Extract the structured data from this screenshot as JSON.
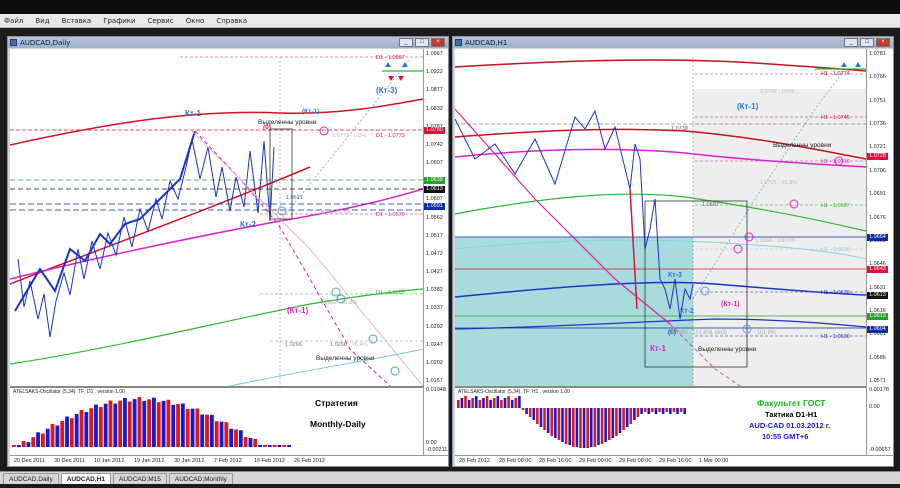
{
  "menu": [
    "Файл",
    "Вид",
    "Вставка",
    "Графики",
    "Сервис",
    "Окно",
    "Справка"
  ],
  "colors": {
    "accent_blue": "#2f74d0",
    "annot_red": "#e0103a",
    "magenta": "#e020c8",
    "green": "#2db82d",
    "tag_red": "#e0103a",
    "tag_black": "#111111",
    "tag_blue": "#0b2ea8",
    "tag_green": "#2aa02a",
    "bar_red": "#e01818",
    "bar_blue": "#1818d8",
    "cyan_zone": "#a8dcdc"
  },
  "window_buttons": {
    "minimize": "_",
    "restore": "□",
    "close": "×"
  },
  "left_window": {
    "title": "AUDCAD,Daily",
    "price_labels": [
      "1.0967",
      "1.0922",
      "1.0877",
      "1.0832",
      "1.0787",
      "1.0742",
      "1.0697",
      "1.0652",
      "1.0607",
      "1.0562",
      "1.0517",
      "1.0472",
      "1.0427",
      "1.0382",
      "1.0337",
      "1.0292",
      "1.0247",
      "1.0202",
      "1.0157"
    ],
    "price_tags": [
      {
        "text": "1.0780",
        "color": "tag_red"
      },
      {
        "text": "1.0638",
        "color": "tag_green"
      },
      {
        "text": "1.0613",
        "color": "tag_black"
      },
      {
        "text": "1.0591",
        "color": "tag_blue"
      }
    ],
    "time_labels": [
      "20 Dec 2011",
      "30 Dec 2011",
      "10 Jan 2012",
      "19 Jan 2012",
      "30 Jan 2012",
      "7 Feb 2012",
      "16 Feb 2012",
      "26 Feb 2012"
    ],
    "annotations": {
      "kt1": "Кт-1",
      "kt2": "Кт-2",
      "kt3": "(Кт-3)",
      "kt1_paren": "(Кт-1)",
      "kt1_paren_small": "(Кт-1)",
      "zero": "(0)",
      "levels_top": "Выделенны уровни",
      "levels_bottom": "Выделенны уровни",
      "l_d1_0967": "D1 - 1.0967",
      "l_d1_0773": "D1 - 1.0773",
      "l_d1_0579": "D1 - 1.0579",
      "l_d1_0385": "D1 - 1.0385",
      "l_0621": "1.0621",
      "l_0266": "1.0266",
      "l_0266b": "1.0266",
      "l_0369": "1.0369 - 61.8%",
      "l_0773s": "1.0773 - 0.0%",
      "l_0534": "1.0534 - 36.8%",
      "l_764": "76.4%"
    },
    "osc_label": "ATELSAKS-Oscillator (5,34). TF: D1 . version 1.00",
    "osc_scale": [
      "0.01948",
      "0.00",
      "-0.00211"
    ],
    "strategy_title": "Стратегия",
    "strategy_sub": "Monthly-Daily"
  },
  "right_window": {
    "title": "AUDCAD,H1",
    "price_labels": [
      "1.0781",
      "1.0766",
      "1.0751",
      "1.0736",
      "1.0721",
      "1.0706",
      "1.0691",
      "1.0676",
      "1.0661",
      "1.0646",
      "1.0631",
      "1.0616",
      "1.0601",
      "1.0586",
      "1.0571"
    ],
    "price_tags": [
      {
        "text": "1.0728",
        "color": "tag_red"
      },
      {
        "text": "1.0664",
        "color": "tag_blue"
      },
      {
        "text": "1.0643",
        "color": "tag_red"
      },
      {
        "text": "1.0613",
        "color": "tag_black"
      },
      {
        "text": "1.0613",
        "color": "tag_green"
      },
      {
        "text": "1.0604",
        "color": "tag_blue"
      }
    ],
    "time_labels": [
      "28 Feb 2012",
      "28 Feb 08:00",
      "28 Feb 16:00",
      "29 Feb 00:00",
      "29 Feb 08:00",
      "29 Feb 16:00",
      "1 Mar 00:00"
    ],
    "annotations": {
      "kt1_top": "(Кт-1)",
      "kt1_bottom": "Кт-1",
      "kt2": "Кт-2",
      "kt3": "Кт-3",
      "kt1_paren": "(Кт-1)",
      "zero": "(0)",
      "levels_top": "Выделенны уровни",
      "levels_bottom": "Выделенны уровни",
      "h1_0774": "H1 - 1.0774",
      "h1_0745": "H1 - 1.0745",
      "h1_0716": "H1 - 1.0716",
      "h1_0687": "H1 - 1.0687",
      "h1_0629": "H1 - 1.0629",
      "h1_0600": "H1 - 1.0600",
      "h1_0658": "H1 - 1.0658",
      "l_0762": "1.0762 - 0.0%",
      "l_0739": "1.0739",
      "l_0701": "1.0701 - 61.8%",
      "l_0687": "1.0687",
      "l_0664": "1.0664 - 100.0%",
      "l_0593": "1.0593 - 161.8%",
      "l_0602": "161.8%",
      "l_0609": "1.0609"
    },
    "osc_label": "ATELSAKS-Oscillator (5,34). TF: H1 . version 1.00",
    "osc_scale": [
      "0.00178",
      "0.00",
      "-0.00657"
    ],
    "faculty_title": "Факультет ГОСТ",
    "tactic": "Тактика  D1-H1",
    "pair_date": "AUD-CAD  01.03.2012 г.",
    "time_text": "10:55   GMT+6"
  },
  "tabs": [
    "AUDCAD,Daily",
    "AUDCAD,H1",
    "AUDCAD,M15",
    "AUDCAD,Monthly"
  ],
  "active_tab": 1
}
